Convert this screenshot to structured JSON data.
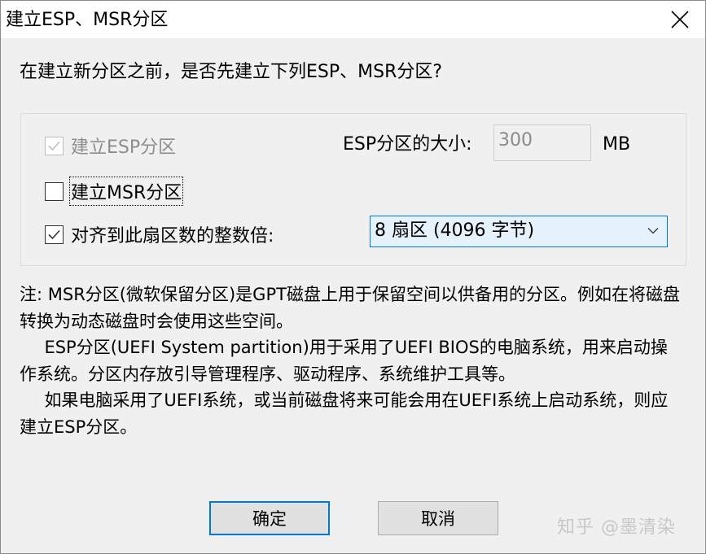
{
  "window": {
    "title": "建立ESP、MSR分区"
  },
  "prompt": "在建立新分区之前，是否先建立下列ESP、MSR分区?",
  "options": {
    "esp": {
      "label": "建立ESP分区",
      "checked": true,
      "disabled": true
    },
    "msr": {
      "label": "建立MSR分区",
      "checked": false
    },
    "align": {
      "label": "对齐到此扇区数的整数倍:",
      "checked": true
    }
  },
  "esp_size": {
    "label": "ESP分区的大小:",
    "value": "300",
    "unit": "MB"
  },
  "align_select": {
    "selected": "8 扇区 (4096 字节)"
  },
  "note": {
    "line1": "注: MSR分区(微软保留分区)是GPT磁盘上用于保留空间以供备用的分区。例如在将磁盘转换为动态磁盘时会使用这些空间。",
    "line2": "ESP分区(UEFI System partition)用于采用了UEFI BIOS的电脑系统，用来启动操作系统。分区内存放引导管理程序、驱动程序、系统维护工具等。",
    "line3": "如果电脑采用了UEFI系统，或当前磁盘将来可能会用在UEFI系统上启动系统，则应建立ESP分区。"
  },
  "buttons": {
    "ok": "确定",
    "cancel": "取消"
  },
  "watermark": "知乎 @墨清染",
  "colors": {
    "accent": "#0078d7",
    "select_bg": "#e5f1fb",
    "dialog_bg": "#f0f0f0"
  }
}
